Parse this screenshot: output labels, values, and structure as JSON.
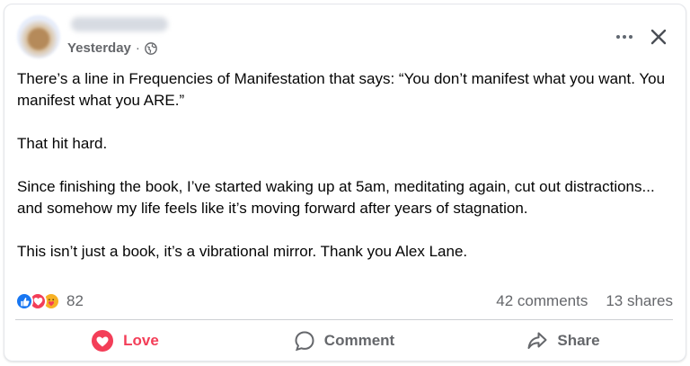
{
  "post": {
    "timestamp": "Yesterday",
    "separator": "·",
    "paragraphs": [
      "There’s a line in Frequencies of Manifestation that says: “You don’t manifest what you want. You manifest what you ARE.”",
      "That hit hard.",
      "Since finishing the book, I’ve started waking up at 5am, meditating again, cut out distractions... and somehow my life feels like it’s moving forward after years of stagnation.",
      "This isn’t just a book, it’s a vibrational mirror. Thank you Alex Lane."
    ]
  },
  "stats": {
    "reaction_count": "82",
    "comments": "42 comments",
    "shares": "13 shares",
    "reaction_icons": [
      "like-icon",
      "love-icon",
      "care-icon"
    ]
  },
  "actions": {
    "love_label": "Love",
    "comment_label": "Comment",
    "share_label": "Share"
  },
  "colors": {
    "love": "#f33e58",
    "like": "#1877f2",
    "care": "#f7b125",
    "secondary_text": "#65676b"
  }
}
